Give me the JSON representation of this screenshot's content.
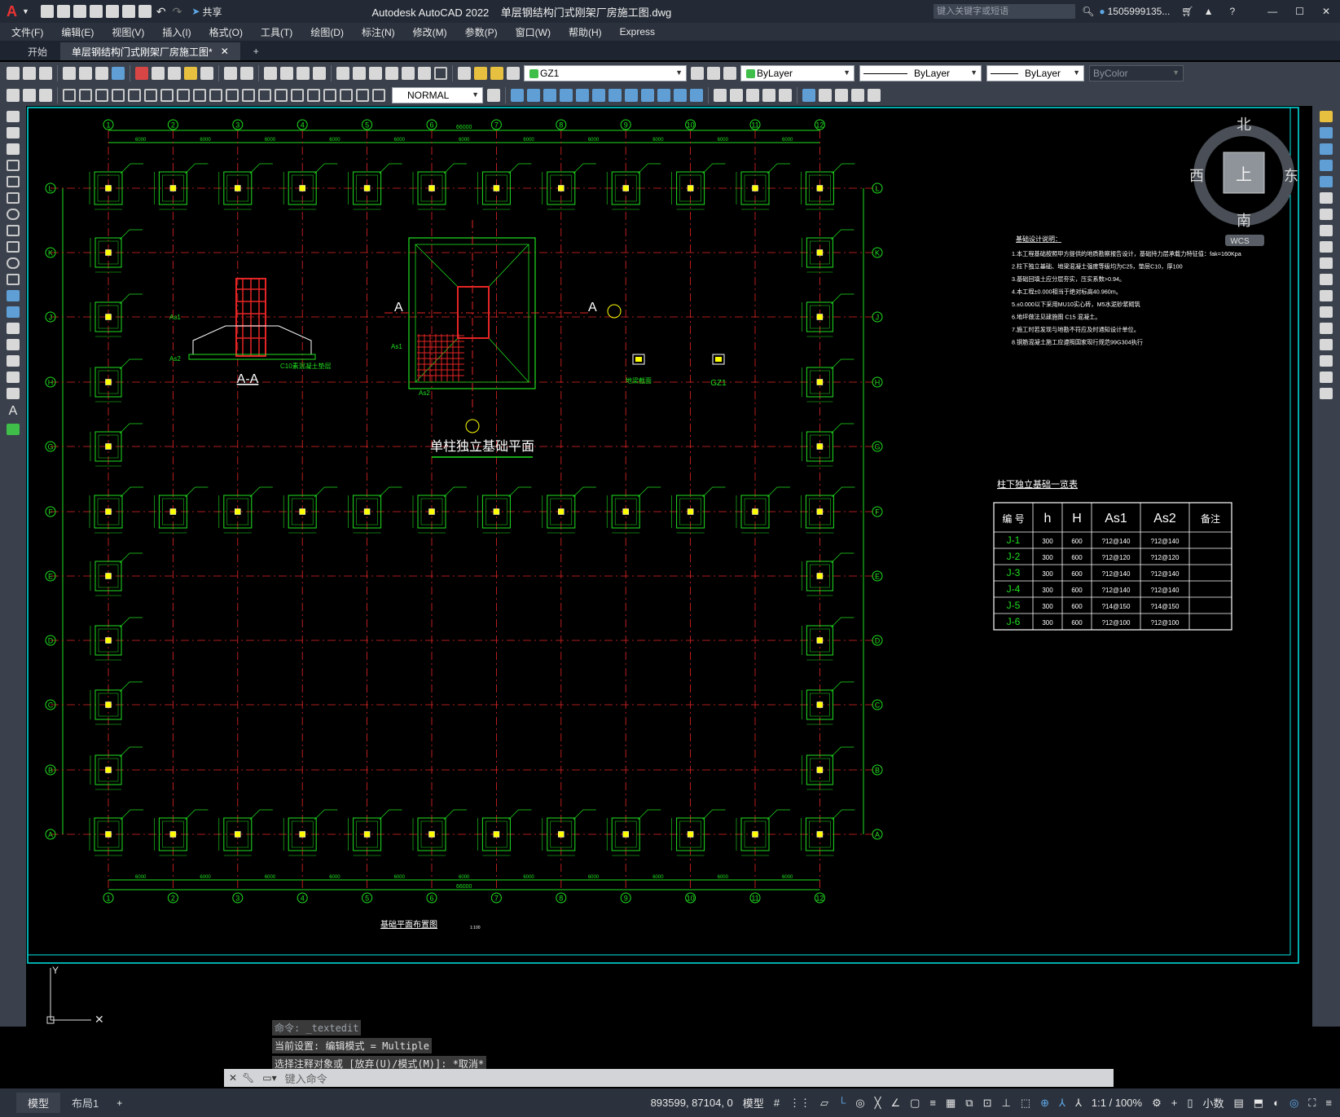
{
  "app": {
    "logo": "A",
    "title": "Autodesk AutoCAD 2022    单层钢结构门式刚架厂房施工图.dwg",
    "search_placeholder": "键入关键字或短语",
    "user": "1505999135...",
    "share": "共享"
  },
  "menu": [
    "文件(F)",
    "编辑(E)",
    "视图(V)",
    "插入(I)",
    "格式(O)",
    "工具(T)",
    "绘图(D)",
    "标注(N)",
    "修改(M)",
    "参数(P)",
    "窗口(W)",
    "帮助(H)",
    "Express"
  ],
  "tabs": [
    "开始",
    "单层钢结构门式刚架厂房施工图*"
  ],
  "toolbar": {
    "layer": "GZ1",
    "color": "ByLayer",
    "linetype": "ByLayer",
    "lineweight": "ByLayer",
    "plotstyle": "ByColor",
    "textstyle": "NORMAL"
  },
  "viewcube": {
    "north": "北",
    "south": "南",
    "east": "东",
    "west": "西",
    "top": "上",
    "wcs": "WCS"
  },
  "drawing": {
    "grid_cols": [
      "1",
      "2",
      "3",
      "4",
      "5",
      "6",
      "7",
      "8",
      "9",
      "10",
      "11",
      "12"
    ],
    "grid_rows": [
      "L",
      "K",
      "J",
      "H",
      "G",
      "F",
      "E",
      "D",
      "C",
      "B",
      "A"
    ],
    "top_dims": [
      "6000",
      "6000",
      "6000",
      "6000",
      "6000",
      "6000",
      "6000",
      "6000",
      "6000",
      "6000",
      "6000"
    ],
    "total_dim": "66000",
    "plan_title": "基础平面布置图",
    "plan_scale": "1:100",
    "section_title": "A-A",
    "section_note": "C10素混凝土垫层",
    "detail_title": "单柱独立基础平面",
    "detail_labels": {
      "as1": "As1",
      "as2": "As2",
      "cut": "A",
      "beam1": "地梁截面",
      "gz1": "GZ1"
    },
    "notes_title": "基础设计说明：",
    "notes": [
      "1.本工程基础按照甲方提供的地质勘察报告设计，基础持力层承载力特征值：fak=160Kpa",
      "2.柱下独立基础、地梁混凝土强度等级均为C25，垫层C10，厚100",
      "3.基础回填土应分层夯实，压实系数>0.94。",
      "4.本工程±0.000相当于绝对标高40.960m。",
      "5.±0.000以下采用MU10实心砖，M5水泥砂浆砌筑",
      "6.地坪做法见建施图 C15 混凝土。",
      "7.施工时若发现与地勘不符应及时通知设计单位。",
      "8.钢筋混凝土施工应遵照国家现行规范99G304执行"
    ],
    "table_title": "柱下独立基础一览表",
    "table": {
      "headers": [
        "编 号",
        "h",
        "H",
        "As1",
        "As2",
        "备注"
      ],
      "rows": [
        [
          "J-1",
          "300",
          "600",
          "?12@140",
          "?12@140",
          ""
        ],
        [
          "J-2",
          "300",
          "600",
          "?12@120",
          "?12@120",
          ""
        ],
        [
          "J-3",
          "300",
          "600",
          "?12@140",
          "?12@140",
          ""
        ],
        [
          "J-4",
          "300",
          "600",
          "?12@140",
          "?12@140",
          ""
        ],
        [
          "J-5",
          "300",
          "600",
          "?14@150",
          "?14@150",
          ""
        ],
        [
          "J-6",
          "300",
          "600",
          "?12@100",
          "?12@100",
          ""
        ]
      ]
    }
  },
  "command": {
    "history": [
      "命令: _textedit",
      "当前设置: 编辑模式 = Multiple",
      "选择注释对象或 [放弃(U)/模式(M)]: *取消*"
    ],
    "placeholder": "键入命令"
  },
  "status": {
    "model_tab": "模型",
    "layout_tab": "布局1",
    "coords": "893599, 87104, 0",
    "space": "模型",
    "scale": "1:1 / 100%",
    "units": "小数"
  }
}
